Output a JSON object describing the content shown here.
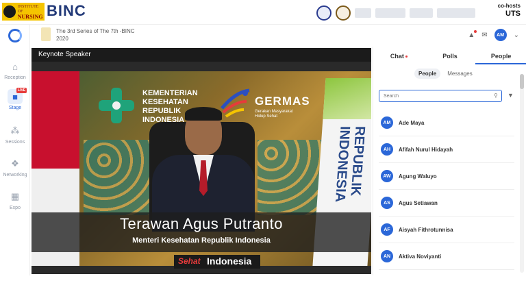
{
  "banner": {
    "logo_ui_line1": "INSTITUTE OF",
    "logo_ui_line2": "NURSING",
    "logo_binc": "BINC",
    "cohosts": "co-hosts",
    "uts": "UTS"
  },
  "nav": {
    "items": [
      {
        "label": "Reception",
        "icon": "home-icon"
      },
      {
        "label": "Stage",
        "icon": "video-camera-icon",
        "badge": "LIVE"
      },
      {
        "label": "Sessions",
        "icon": "sessions-icon"
      },
      {
        "label": "Networking",
        "icon": "handshake-icon"
      },
      {
        "label": "Expo",
        "icon": "booth-icon"
      }
    ]
  },
  "event": {
    "title_line1": "The 3rd Series of The 7th -BINC",
    "title_line2": "2020",
    "avatar": "AM"
  },
  "stage": {
    "label": "Keynote Speaker",
    "kemkes": [
      "KEMENTERIAN",
      "KESEHATAN",
      "REPUBLIK",
      "INDONESIA"
    ],
    "germas": "GERMAS",
    "germas_sub1": "Gerakan Masyarakat",
    "germas_sub2": "Hidup Sehat",
    "banner_vertical": "REPUBLIK INDONESIA",
    "speaker_name": "Terawan Agus Putranto",
    "speaker_role": "Menteri Kesehatan Republik Indonesia",
    "sehat_1": "Sehat",
    "sehat_2": "Indonesia"
  },
  "panel": {
    "tabs": [
      "Chat",
      "Polls",
      "People"
    ],
    "subtabs": [
      "People",
      "Messages"
    ],
    "search_placeholder": "Search",
    "people": [
      {
        "initials": "AM",
        "name": "Ade Maya"
      },
      {
        "initials": "AH",
        "name": "Afifah Nurul Hidayah"
      },
      {
        "initials": "AW",
        "name": "Agung Waluyo"
      },
      {
        "initials": "AS",
        "name": "Agus Setiawan"
      },
      {
        "initials": "AF",
        "name": "Aisyah Fithrotunnisa"
      },
      {
        "initials": "AN",
        "name": "Aktiva Noviyanti"
      }
    ]
  },
  "colors": {
    "accent": "#2b67d8",
    "live": "#e63b3b"
  }
}
